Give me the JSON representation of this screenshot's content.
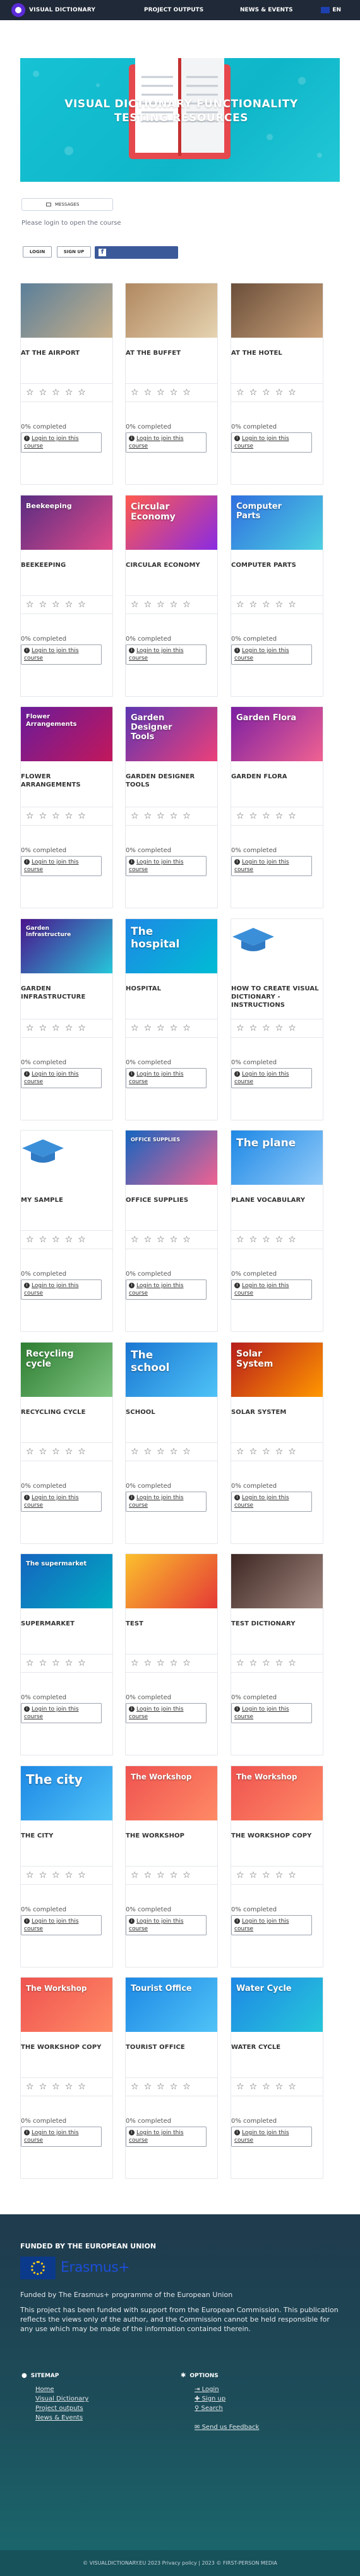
{
  "nav": {
    "logo_text": "VISUAL DICTIONARY",
    "items": [
      "PROJECT OUTPUTS",
      "NEWS & EVENTS"
    ],
    "lang": "EN"
  },
  "banner": {
    "title": "VISUAL DICTIONARY FUNCTIONALITY TESTING RESOURCES"
  },
  "controls": {
    "messages_label": "MESSAGES",
    "login_hint": "Please login to open the course",
    "login_label": "LOGIN",
    "signup_label": "SIGN UP"
  },
  "card_common": {
    "progress": "0% completed",
    "join_label": "Login to join this course"
  },
  "courses": [
    {
      "title": "AT THE AIRPORT",
      "image_caption": ""
    },
    {
      "title": "AT THE BUFFET",
      "image_caption": ""
    },
    {
      "title": "AT THE HOTEL",
      "image_caption": ""
    },
    {
      "title": "BEEKEEPING",
      "image_caption": "Beekeeping"
    },
    {
      "title": "CIRCULAR ECONOMY",
      "image_caption": "Circular Economy"
    },
    {
      "title": "COMPUTER PARTS",
      "image_caption": "Computer Parts"
    },
    {
      "title": "FLOWER ARRANGEMENTS",
      "image_caption": "Flower Arrangements"
    },
    {
      "title": "GARDEN DESIGNER TOOLS",
      "image_caption": "Garden Designer Tools"
    },
    {
      "title": "GARDEN FLORA",
      "image_caption": "Garden Flora"
    },
    {
      "title": "GARDEN INFRASTRUCTURE",
      "image_caption": "Garden Infrastructure"
    },
    {
      "title": "HOSPITAL",
      "image_caption": "The hospital"
    },
    {
      "title": "HOW TO CREATE VISUAL DICTIONARY - INSTRUCTIONS",
      "image_caption": ""
    },
    {
      "title": "MY SAMPLE",
      "image_caption": ""
    },
    {
      "title": "OFFICE SUPPLIES",
      "image_caption": "OFFICE SUPPLIES"
    },
    {
      "title": "PLANE VOCABULARY",
      "image_caption": "The plane"
    },
    {
      "title": "RECYCLING CYCLE",
      "image_caption": "Recycling cycle"
    },
    {
      "title": "SCHOOL",
      "image_caption": "The school"
    },
    {
      "title": "SOLAR SYSTEM",
      "image_caption": "Solar System"
    },
    {
      "title": "SUPERMARKET",
      "image_caption": "The supermarket"
    },
    {
      "title": "TEST",
      "image_caption": ""
    },
    {
      "title": "TEST DICTIONARY",
      "image_caption": ""
    },
    {
      "title": "THE CITY",
      "image_caption": "The city"
    },
    {
      "title": "THE WORKSHOP",
      "image_caption": "The Workshop"
    },
    {
      "title": "THE WORKSHOP COPY",
      "image_caption": "The Workshop"
    },
    {
      "title": "THE WORKSHOP COPY",
      "image_caption": "The Workshop"
    },
    {
      "title": "TOURIST OFFICE",
      "image_caption": "Tourist Office"
    },
    {
      "title": "WATER CYCLE",
      "image_caption": "Water Cycle"
    }
  ],
  "footer": {
    "funded_title": "FUNDED BY THE EUROPEAN UNION",
    "erasmus": "Erasmus+",
    "funded_text": "Funded by The Erasmus+ programme of the European Union",
    "disclaimer": "This project has been funded with support from the European Commission. This publication reflects the views only of the author, and the Commission cannot be held responsible for any use which may be made of the information contained therein.",
    "sitemap_title": "SITEMAP",
    "sitemap_links": [
      "Home",
      "Visual Dictionary",
      "Project outputs",
      "News & Events"
    ],
    "options_title": "OPTIONS",
    "options_links": [
      "Login",
      "Sign up",
      "Search"
    ],
    "feedback": "Send us Feedback",
    "copyright": "© VISUALDICTIONARY.EU 2023 Privacy policy | 2023 © FIRST-PERSON MEDIA"
  }
}
